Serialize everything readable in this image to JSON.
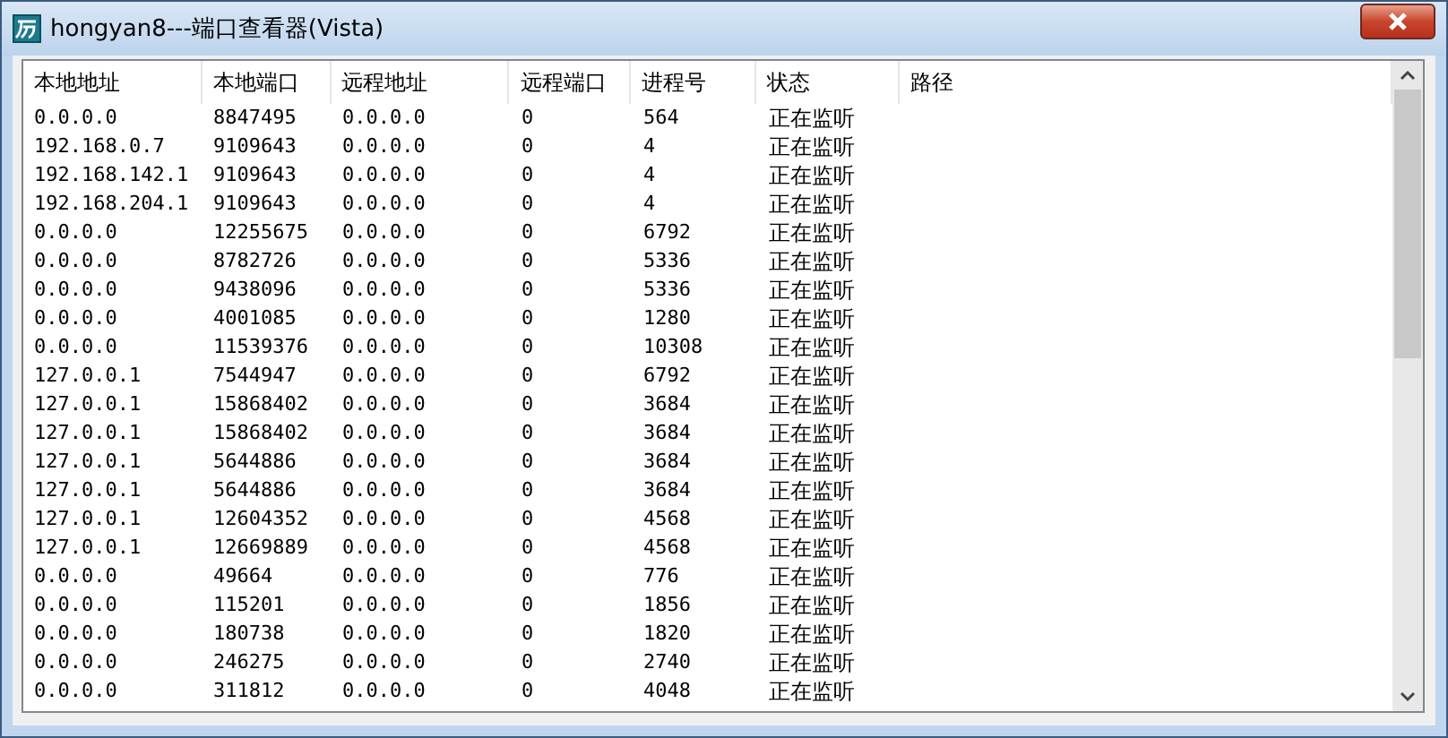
{
  "window": {
    "title": "hongyan8---端口查看器(Vista)"
  },
  "table": {
    "columns": [
      "本地地址",
      "本地端口",
      "远程地址",
      "远程端口",
      "进程号",
      "状态",
      "路径"
    ],
    "rows": [
      [
        "0.0.0.0",
        "8847495",
        "0.0.0.0",
        "0",
        "564",
        "正在监听"
      ],
      [
        "192.168.0.7",
        "9109643",
        "0.0.0.0",
        "0",
        "4",
        "正在监听"
      ],
      [
        "192.168.142.1",
        "9109643",
        "0.0.0.0",
        "0",
        "4",
        "正在监听"
      ],
      [
        "192.168.204.1",
        "9109643",
        "0.0.0.0",
        "0",
        "4",
        "正在监听"
      ],
      [
        "0.0.0.0",
        "12255675",
        "0.0.0.0",
        "0",
        "6792",
        "正在监听"
      ],
      [
        "0.0.0.0",
        "8782726",
        "0.0.0.0",
        "0",
        "5336",
        "正在监听"
      ],
      [
        "0.0.0.0",
        "9438096",
        "0.0.0.0",
        "0",
        "5336",
        "正在监听"
      ],
      [
        "0.0.0.0",
        "4001085",
        "0.0.0.0",
        "0",
        "1280",
        "正在监听"
      ],
      [
        "0.0.0.0",
        "11539376",
        "0.0.0.0",
        "0",
        "10308",
        "正在监听"
      ],
      [
        "127.0.0.1",
        "7544947",
        "0.0.0.0",
        "0",
        "6792",
        "正在监听"
      ],
      [
        "127.0.0.1",
        "15868402",
        "0.0.0.0",
        "0",
        "3684",
        "正在监听"
      ],
      [
        "127.0.0.1",
        "15868402",
        "0.0.0.0",
        "0",
        "3684",
        "正在监听"
      ],
      [
        "127.0.0.1",
        "5644886",
        "0.0.0.0",
        "0",
        "3684",
        "正在监听"
      ],
      [
        "127.0.0.1",
        "5644886",
        "0.0.0.0",
        "0",
        "3684",
        "正在监听"
      ],
      [
        "127.0.0.1",
        "12604352",
        "0.0.0.0",
        "0",
        "4568",
        "正在监听"
      ],
      [
        "127.0.0.1",
        "12669889",
        "0.0.0.0",
        "0",
        "4568",
        "正在监听"
      ],
      [
        "0.0.0.0",
        "49664",
        "0.0.0.0",
        "0",
        "776",
        "正在监听"
      ],
      [
        "0.0.0.0",
        "115201",
        "0.0.0.0",
        "0",
        "1856",
        "正在监听"
      ],
      [
        "0.0.0.0",
        "180738",
        "0.0.0.0",
        "0",
        "1820",
        "正在监听"
      ],
      [
        "0.0.0.0",
        "246275",
        "0.0.0.0",
        "0",
        "2740",
        "正在监听"
      ],
      [
        "0.0.0.0",
        "311812",
        "0.0.0.0",
        "0",
        "4048",
        "正在监听"
      ]
    ]
  }
}
